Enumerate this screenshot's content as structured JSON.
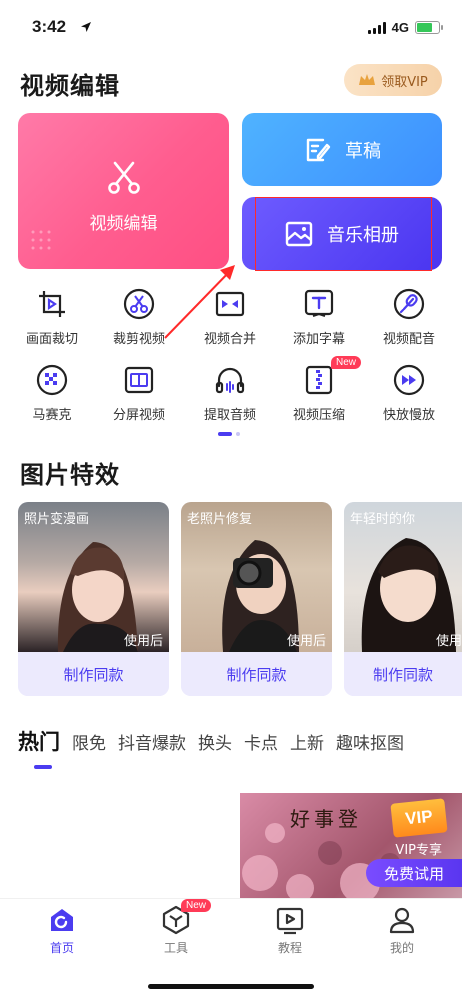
{
  "status": {
    "time": "3:42",
    "network": "4G"
  },
  "header": {
    "title": "视频编辑",
    "vip_label": "领取VIP"
  },
  "cards": {
    "edit_label": "视频编辑",
    "draft_label": "草稿",
    "album_label": "音乐相册"
  },
  "tools": [
    {
      "label": "画面裁切",
      "icon": "crop-icon"
    },
    {
      "label": "裁剪视频",
      "icon": "scissors-icon"
    },
    {
      "label": "视频合并",
      "icon": "merge-icon"
    },
    {
      "label": "添加字幕",
      "icon": "subtitle-icon"
    },
    {
      "label": "视频配音",
      "icon": "dubbing-icon"
    },
    {
      "label": "马赛克",
      "icon": "mosaic-icon"
    },
    {
      "label": "分屏视频",
      "icon": "split-screen-icon"
    },
    {
      "label": "提取音频",
      "icon": "headphones-icon"
    },
    {
      "label": "视频压缩",
      "icon": "compress-icon",
      "badge": "New"
    },
    {
      "label": "快放慢放",
      "icon": "speed-icon"
    }
  ],
  "effects": {
    "title": "图片特效",
    "items": [
      {
        "tag": "照片变漫画",
        "after": "使用后",
        "button": "制作同款"
      },
      {
        "tag": "老照片修复",
        "after": "使用后",
        "button": "制作同款"
      },
      {
        "tag": "年轻时的你",
        "after": "使用",
        "button": "制作同款"
      }
    ]
  },
  "tabs": [
    "热门",
    "限免",
    "抖音爆款",
    "换头",
    "卡点",
    "上新",
    "趣味抠图"
  ],
  "promo": {
    "calligraphy": "好事登",
    "vip_badge": "VIP",
    "vip_text": "VIP专享",
    "trial": "免费试用"
  },
  "nav": [
    {
      "label": "首页",
      "active": true
    },
    {
      "label": "工具",
      "badge": "New"
    },
    {
      "label": "教程"
    },
    {
      "label": "我的"
    }
  ],
  "colors": {
    "accent": "#4b3cf0",
    "pink": "#ff5d8f",
    "blue": "#3d8fff",
    "purple": "#5a44f5",
    "annotation_red": "#ff2a2a"
  }
}
